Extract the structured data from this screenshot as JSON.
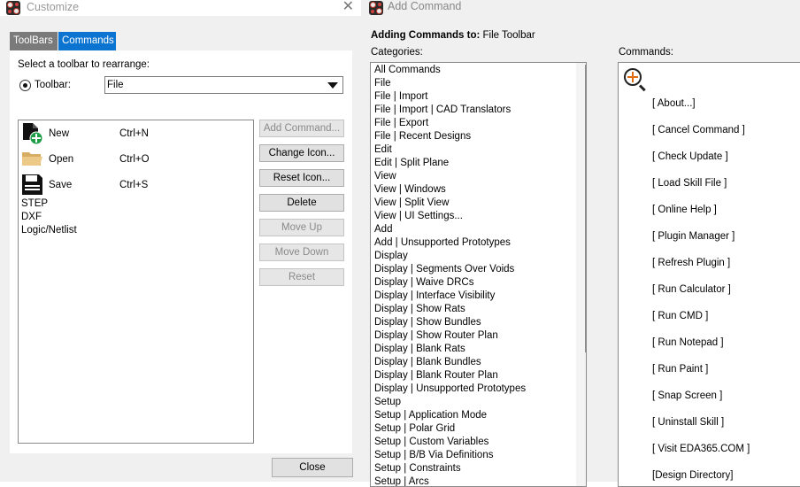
{
  "customize": {
    "title": "Customize",
    "tabs": [
      "ToolBars",
      "Commands"
    ],
    "select_label": "Select a toolbar to rearrange:",
    "toolbar_label": "Toolbar:",
    "toolbar_value": "File",
    "commands": [
      {
        "name": "New",
        "shortcut": "Ctrl+N"
      },
      {
        "name": "Open",
        "shortcut": "Ctrl+O"
      },
      {
        "name": "Save",
        "shortcut": "Ctrl+S"
      }
    ],
    "plain_items": [
      "STEP",
      "DXF",
      "Logic/Netlist"
    ],
    "buttons": {
      "add_command": "Add Command...",
      "change_icon": "Change Icon...",
      "reset_icon": "Reset Icon...",
      "delete": "Delete",
      "move_up": "Move Up",
      "move_down": "Move Down",
      "reset": "Reset"
    },
    "close": "Close"
  },
  "add_command": {
    "title": "Add Command",
    "adding_label": "Adding Commands to:",
    "adding_target": "File Toolbar",
    "categories_label": "Categories:",
    "commands_label": "Commands:",
    "categories": [
      "All Commands",
      "File",
      "File | Import",
      "File | Import | CAD Translators",
      "File | Export",
      "File | Recent Designs",
      "Edit",
      "Edit | Split Plane",
      "View",
      "View | Windows",
      "View | Split View",
      "View | UI Settings...",
      "Add",
      "Add | Unsupported Prototypes",
      "Display",
      "Display | Segments Over Voids",
      "Display | Waive DRCs",
      "Display | Interface Visibility",
      "Display | Show Rats",
      "Display | Show Bundles",
      "Display | Show Router Plan",
      "Display | Blank Rats",
      "Display | Blank Bundles",
      "Display | Blank Router Plan",
      "Display | Unsupported Prototypes",
      "Setup",
      "Setup | Application Mode",
      "Setup | Polar Grid",
      "Setup | Custom Variables",
      "Setup | B/B Via Definitions",
      "Setup | Constraints",
      "Setup | Arcs"
    ],
    "commands": [
      "[ About...]",
      "[ Cancel Command ]",
      "[ Check Update ]",
      "[ Load Skill File ]",
      "[ Online Help ]",
      "[ Plugin Manager ]",
      "[ Refresh Plugin ]",
      "[ Run Calculator ]",
      "[ Run CMD ]",
      "[ Run Notepad ]",
      "[ Run Paint ]",
      "[ Snap Screen ]",
      "[ Uninstall Skill ]",
      "[ Visit EDA365.COM ]",
      "[Design Directory]"
    ]
  }
}
